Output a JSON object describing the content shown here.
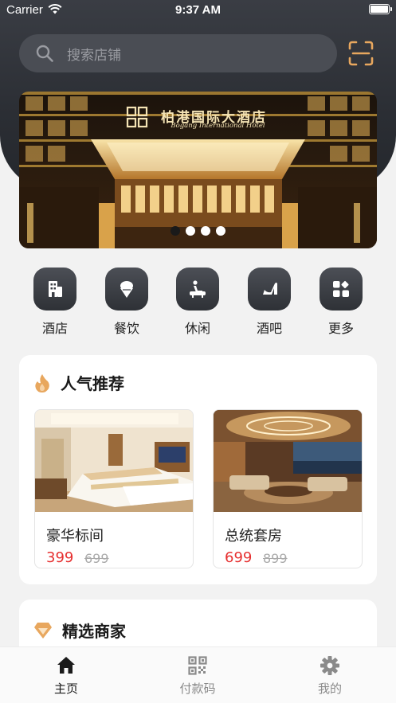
{
  "status_bar": {
    "carrier": "Carrier",
    "time": "9:37 AM"
  },
  "search": {
    "placeholder": "搜索店铺"
  },
  "banner": {
    "title": "柏港国际大酒店",
    "subtitle": "Bogang International Hotel",
    "dots": 4,
    "active_dot": 1
  },
  "categories": [
    {
      "label": "酒店",
      "icon": "building-icon"
    },
    {
      "label": "餐饮",
      "icon": "ice-cream-icon"
    },
    {
      "label": "休闲",
      "icon": "bath-icon"
    },
    {
      "label": "酒吧",
      "icon": "high-heel-icon"
    },
    {
      "label": "更多",
      "icon": "grid-more-icon"
    }
  ],
  "popular": {
    "title": "人气推荐",
    "icon": "flame-icon",
    "rooms": [
      {
        "name": "豪华标间",
        "price": "399",
        "original_price": "699"
      },
      {
        "name": "总统套房",
        "price": "699",
        "original_price": "899"
      }
    ]
  },
  "merchants": {
    "title": "精选商家",
    "icon": "diamond-icon"
  },
  "tabs": [
    {
      "label": "主页",
      "icon": "home-icon",
      "active": true
    },
    {
      "label": "付款码",
      "icon": "qr-code-icon",
      "active": false
    },
    {
      "label": "我的",
      "icon": "gear-icon",
      "active": false
    }
  ],
  "colors": {
    "header": "#2b2e34",
    "price": "#e63030",
    "accent": "#e8a75e"
  }
}
